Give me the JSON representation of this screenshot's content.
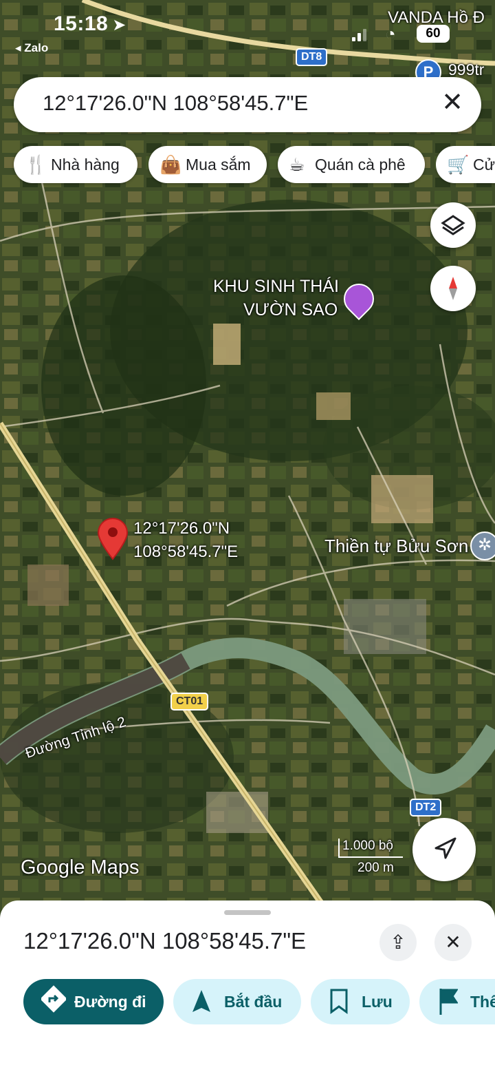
{
  "status_bar": {
    "time": "15:18",
    "back_app": "◂ Zalo",
    "carrier_text": "VANDA Hồ Đ",
    "battery": "60"
  },
  "search": {
    "query": "12°17'26.0\"N 108°58'45.7\"E"
  },
  "chips": [
    {
      "label": "Nhà hàng",
      "icon": "restaurant-icon"
    },
    {
      "label": "Mua sắm",
      "icon": "shopping-bag-icon"
    },
    {
      "label": "Quán cà phê",
      "icon": "coffee-icon"
    },
    {
      "label": "Cử",
      "icon": "cart-icon"
    }
  ],
  "map": {
    "poi_label_1": "KHU SINH THÁI",
    "poi_label_2": "VƯỜN SAO",
    "temple_label": "Thiền tự Bửu Sơn",
    "pin_label_lat": "12°17'26.0\"N",
    "pin_label_lng": "108°58'45.7\"E",
    "road_label": "Đường Tỉnh lộ 2",
    "shield_dt8": "DT8",
    "shield_ct01": "CT01",
    "shield_dt2": "DT2",
    "poi_999": "999tr",
    "scale_feet": "1.000 bộ",
    "scale_meters": "200 m",
    "watermark": "Google Maps"
  },
  "sheet": {
    "title": "12°17'26.0\"N 108°58'45.7\"E",
    "actions": [
      {
        "label": "Đường đi",
        "icon": "directions-icon"
      },
      {
        "label": "Bắt đầu",
        "icon": "navigation-arrow-icon"
      },
      {
        "label": "Lưu",
        "icon": "bookmark-icon"
      },
      {
        "label": "Thê",
        "icon": "flag-icon"
      }
    ]
  },
  "colors": {
    "primary": "#0b5f67",
    "action_bg": "#d6f3fa",
    "pin": "#e53935",
    "road": "#e8d9a0"
  }
}
